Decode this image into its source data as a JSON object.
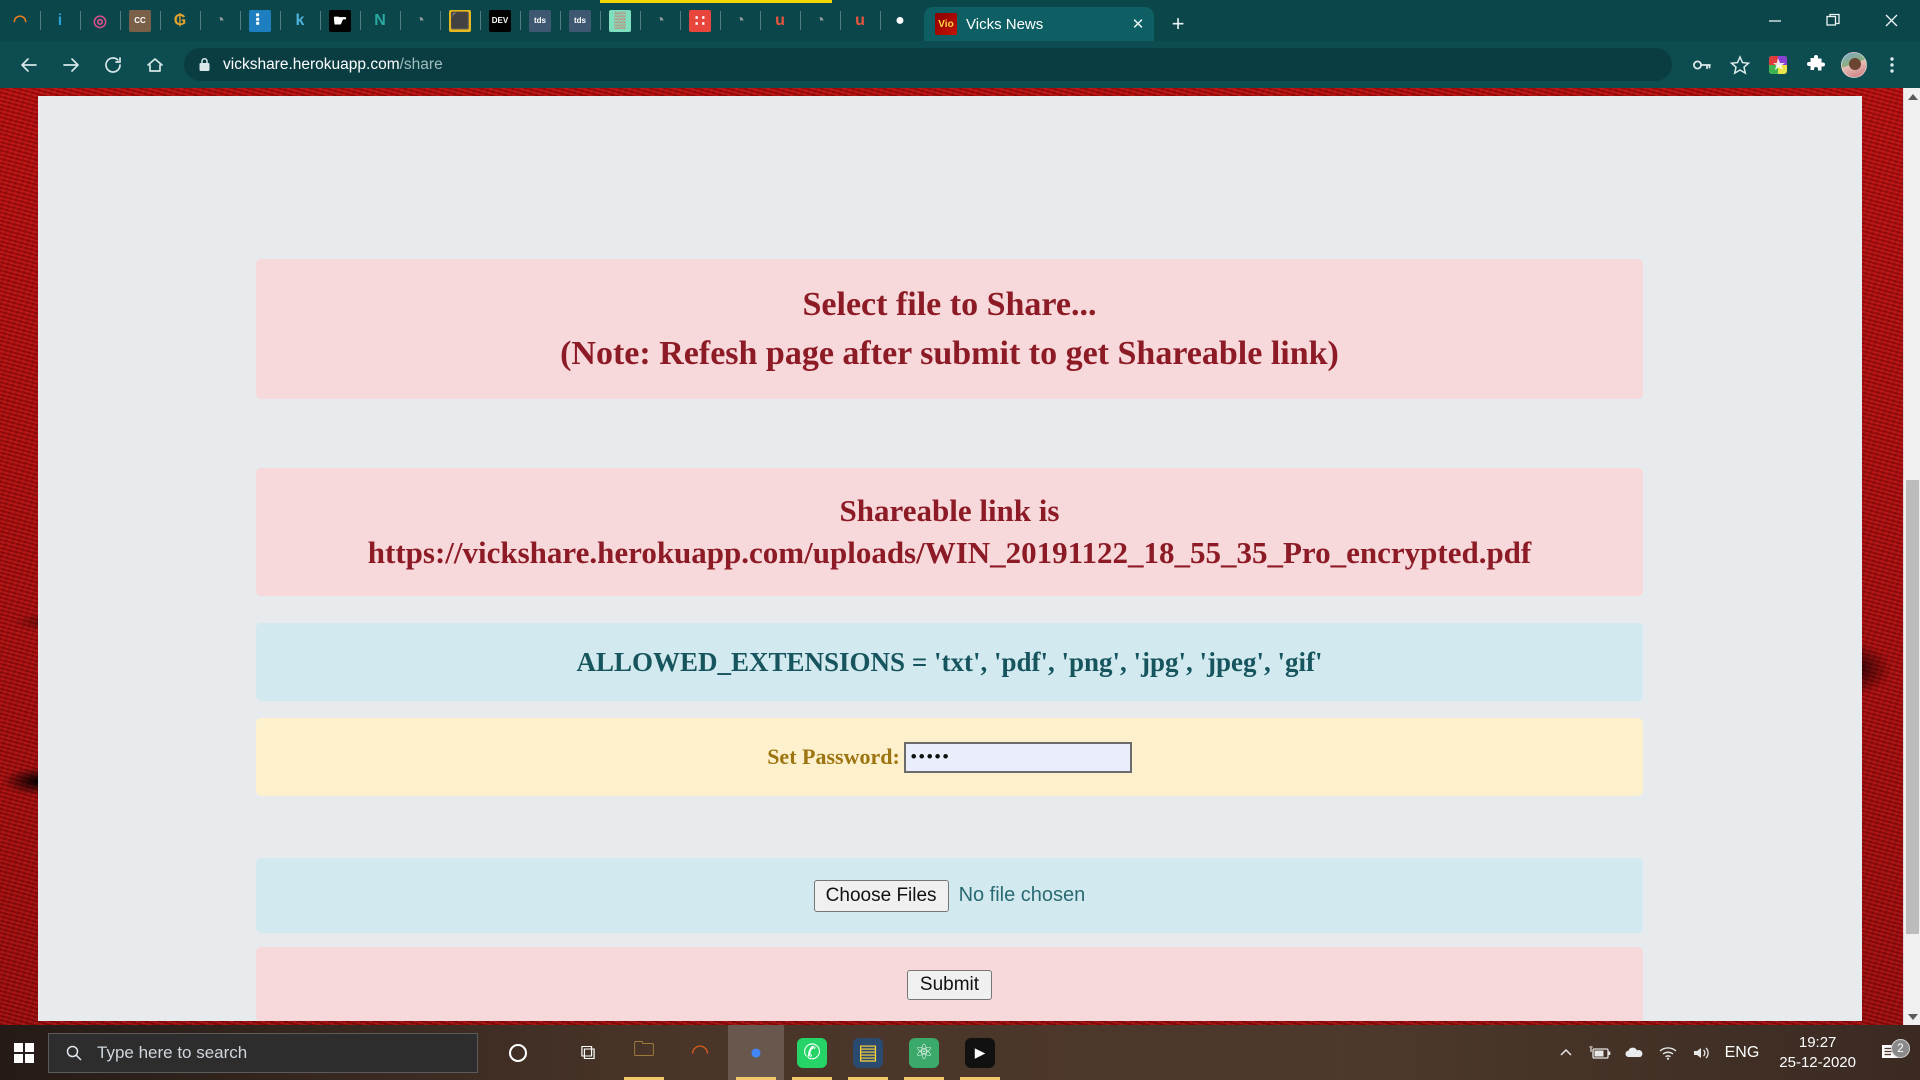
{
  "browser": {
    "pinned_tabs": [
      {
        "name": "tab-favicon-orange-arc",
        "glyph": "◠",
        "bg": "none",
        "fg": "#ef7d1a"
      },
      {
        "name": "tab-favicon-info",
        "glyph": "i",
        "bg": "none",
        "fg": "#2a9fd6"
      },
      {
        "name": "tab-favicon-swirl",
        "glyph": "◎",
        "bg": "none",
        "fg": "#d94f8a"
      },
      {
        "name": "tab-favicon-cc",
        "glyph": "CC",
        "bg": "#7a6048",
        "fg": "#ffffff"
      },
      {
        "name": "tab-favicon-gold-g",
        "glyph": "₲",
        "bg": "none",
        "fg": "#e0a32e"
      },
      {
        "name": "tab-favicon-globe-grey-1",
        "glyph": "◔",
        "bg": "none",
        "fg": "#8c9a9a"
      },
      {
        "name": "tab-favicon-blue-card",
        "glyph": "⠇",
        "bg": "#1d7fc0",
        "fg": "#ffffff"
      },
      {
        "name": "tab-favicon-kaggle-k",
        "glyph": "k",
        "bg": "none",
        "fg": "#4fb3d9"
      },
      {
        "name": "tab-favicon-black-hand",
        "glyph": "☛",
        "bg": "#000000",
        "fg": "#ffffff"
      },
      {
        "name": "tab-favicon-notion-n",
        "glyph": "N",
        "bg": "none",
        "fg": "#2aa9a0"
      },
      {
        "name": "tab-favicon-globe-grey-2",
        "glyph": "◔",
        "bg": "none",
        "fg": "#8c9a9a"
      },
      {
        "name": "tab-favicon-yellow-box",
        "glyph": "⬛",
        "bg": "#e8b820",
        "fg": "#f5f5f5"
      },
      {
        "name": "tab-favicon-dev",
        "glyph": "DEV",
        "bg": "#000000",
        "fg": "#ffffff"
      },
      {
        "name": "tab-favicon-tds-1",
        "glyph": "tds",
        "bg": "#3f5871",
        "fg": "#ffffff"
      },
      {
        "name": "tab-favicon-tds-2",
        "glyph": "tds",
        "bg": "#3f5871",
        "fg": "#ffffff"
      },
      {
        "name": "tab-favicon-color-grid",
        "glyph": "▒",
        "bg": "#7fe0c0",
        "fg": "#ff3b3b"
      },
      {
        "name": "tab-favicon-globe-grey-3",
        "glyph": "◔",
        "bg": "none",
        "fg": "#8c9a9a"
      },
      {
        "name": "tab-favicon-red-dots",
        "glyph": "∷",
        "bg": "#e8453c",
        "fg": "#ffffff"
      },
      {
        "name": "tab-favicon-globe-grey-4",
        "glyph": "◔",
        "bg": "none",
        "fg": "#8c9a9a"
      },
      {
        "name": "tab-favicon-red-u",
        "glyph": "u",
        "bg": "none",
        "fg": "#e8553f"
      },
      {
        "name": "tab-favicon-globe-grey-5",
        "glyph": "◔",
        "bg": "none",
        "fg": "#8c9a9a"
      },
      {
        "name": "tab-favicon-red-u-2",
        "glyph": "u",
        "bg": "none",
        "fg": "#e8553f"
      },
      {
        "name": "tab-favicon-github",
        "glyph": "●",
        "bg": "none",
        "fg": "#ffffff"
      }
    ],
    "active_tab": {
      "title": "Vicks News",
      "favicon_name": "vicks-news-favicon",
      "favicon_text": "Viᴏ",
      "close_label": "✕"
    },
    "new_tab_label": "+",
    "window_controls": {
      "minimize": "—",
      "maximize": "❐",
      "close": "✕"
    },
    "nav": {
      "back": "←",
      "forward": "→",
      "reload": "↻",
      "home": "⌂"
    },
    "omnibox": {
      "host": "vickshare.herokuapp.com",
      "path": "/share",
      "lock_icon": "lock-icon"
    },
    "toolbar_right": [
      {
        "name": "password-key-icon",
        "glyph": "⚷"
      },
      {
        "name": "bookmark-star-icon",
        "glyph": "☆"
      },
      {
        "name": "extension-colorful-icon",
        "glyph": "❖"
      },
      {
        "name": "extensions-puzzle-icon",
        "glyph": "❖"
      },
      {
        "name": "profile-avatar",
        "glyph": ""
      },
      {
        "name": "chrome-menu-icon",
        "glyph": "⋮"
      }
    ]
  },
  "page": {
    "header": {
      "line1": "Select file to Share...",
      "line2": "(Note: Refesh page after submit to get Shareable link)"
    },
    "share": {
      "label": "Shareable link is",
      "url": "https://vickshare.herokuapp.com/uploads/WIN_20191122_18_55_35_Pro_encrypted.pdf"
    },
    "extensions_note": "ALLOWED_EXTENSIONS = 'txt', 'pdf', 'png', 'jpg', 'jpeg', 'gif'",
    "password": {
      "label": "Set Password:",
      "value": "•••••",
      "placeholder": ""
    },
    "file_input": {
      "button_label": "Choose Files",
      "status": "No file chosen"
    },
    "submit_label": "Submit",
    "colors": {
      "pink": "#f7d8db",
      "blue": "#d2eaef",
      "cream": "#fdf0cd",
      "sheet": "#e7ebee",
      "maroon_text": "#8c1b26",
      "teal_text": "#17555e",
      "gold_text": "#9d7510",
      "body_red": "#c00d0d"
    }
  },
  "scrollbar": {
    "up_arrow": "▲",
    "down_arrow": "▼"
  },
  "taskbar": {
    "start_label": "start-button",
    "search_placeholder": "Type here to search",
    "cortana_label": "○",
    "apps": [
      {
        "name": "taskbar-task-view",
        "glyph": "⧉",
        "open": false,
        "active": false,
        "fg": "#ffffff",
        "bg": "none"
      },
      {
        "name": "taskbar-file-explorer",
        "glyph": "🗀",
        "open": true,
        "active": false,
        "fg": "#f0c04a",
        "bg": "none"
      },
      {
        "name": "taskbar-ubuntu",
        "glyph": "◠",
        "open": false,
        "active": false,
        "fg": "#e8601c",
        "bg": "none"
      },
      {
        "name": "taskbar-chrome",
        "glyph": "●",
        "open": true,
        "active": true,
        "fg": "#4285f4",
        "bg": "none"
      },
      {
        "name": "taskbar-whatsapp",
        "glyph": "✆",
        "open": true,
        "active": false,
        "fg": "#ffffff",
        "bg": "#25d366"
      },
      {
        "name": "taskbar-python-ide",
        "glyph": "▤",
        "open": true,
        "active": false,
        "fg": "#ffd43b",
        "bg": "#2b4a6f"
      },
      {
        "name": "taskbar-atom",
        "glyph": "⚛",
        "open": true,
        "active": false,
        "fg": "#ffffff",
        "bg": "#3aa96a"
      },
      {
        "name": "taskbar-terminal",
        "glyph": "▸",
        "open": true,
        "active": false,
        "fg": "#ffffff",
        "bg": "#111111"
      }
    ],
    "tray": [
      {
        "name": "tray-show-hidden-icons",
        "glyph": "∧"
      },
      {
        "name": "tray-battery-charging-icon",
        "glyph": "▰"
      },
      {
        "name": "tray-onedrive-cloud-icon",
        "glyph": "☁"
      },
      {
        "name": "tray-wifi-icon",
        "glyph": "◠"
      },
      {
        "name": "tray-volume-icon",
        "glyph": "ᴘ"
      }
    ],
    "language": "ENG",
    "time": "19:27",
    "date": "25-12-2020",
    "notification_count": "2"
  }
}
